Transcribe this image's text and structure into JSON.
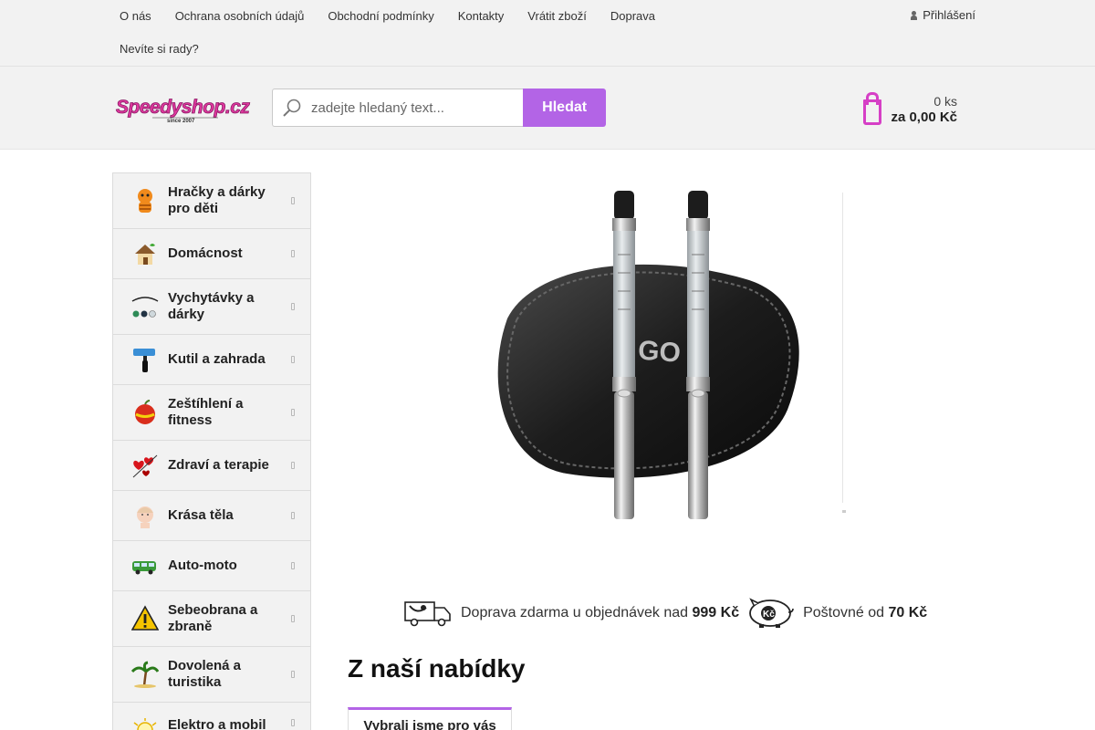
{
  "topnav": {
    "links": [
      "O nás",
      "Ochrana osobních údajů",
      "Obchodní podmínky",
      "Kontakty",
      "Vrátit zboží",
      "Doprava",
      "Nevíte si rady?"
    ],
    "login_label": "Přihlášení"
  },
  "header": {
    "logo_text": "Speedyshop.cz",
    "logo_subtext": "since 2007",
    "search_placeholder": "zadejte hledaný text...",
    "search_button": "Hledat",
    "cart_count": "0 ks",
    "cart_total": "za 0,00 Kč"
  },
  "sidebar": {
    "categories": [
      {
        "label": "Hračky a dárky pro děti",
        "icon": "tiger-toy-icon"
      },
      {
        "label": "Domácnost",
        "icon": "house-icon"
      },
      {
        "label": "Vychytávky a dárky",
        "icon": "gadgets-icon"
      },
      {
        "label": "Kutil a zahrada",
        "icon": "paint-roller-icon"
      },
      {
        "label": "Zeštíhlení a fitness",
        "icon": "apple-tape-icon"
      },
      {
        "label": "Zdraví a terapie",
        "icon": "hearts-icon"
      },
      {
        "label": "Krása těla",
        "icon": "face-icon"
      },
      {
        "label": "Auto-moto",
        "icon": "van-icon"
      },
      {
        "label": "Sebeobrana a zbraně",
        "icon": "warning-icon"
      },
      {
        "label": "Dovolená a turistika",
        "icon": "palm-icon"
      },
      {
        "label": "Elektro a mobil",
        "icon": "bulb-icon"
      }
    ]
  },
  "banner": {
    "case_text": "GO",
    "alt": "e-cigarette set"
  },
  "shipping": {
    "free_text": "Doprava zdarma u objednávek nad",
    "free_amount": "999 Kč",
    "postage_text": "Poštovné od",
    "postage_amount": "70 Kč",
    "money_badge": "Kč"
  },
  "offer": {
    "title": "Z naší nabídky",
    "tab_label": "Vybrali jsme pro vás"
  },
  "colors": {
    "accent": "#b364e6",
    "cart": "#d63fc6",
    "bar_bg": "#f2f2f2"
  }
}
